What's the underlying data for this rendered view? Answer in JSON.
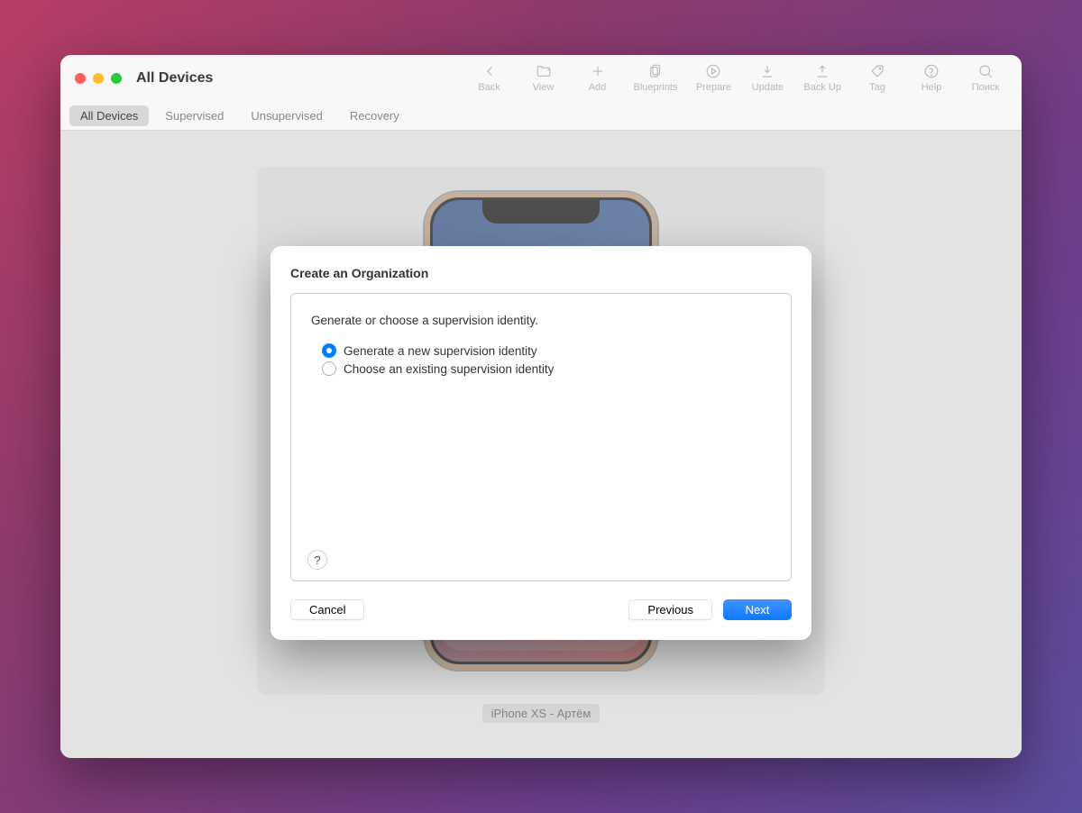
{
  "window": {
    "title": "All Devices"
  },
  "toolbar": {
    "back": "Back",
    "view": "View",
    "add": "Add",
    "blueprints": "Blueprints",
    "prepare": "Prepare",
    "update": "Update",
    "backup": "Back Up",
    "tag": "Tag",
    "help": "Help",
    "search": "Поиск"
  },
  "tabs": {
    "all": "All Devices",
    "supervised": "Supervised",
    "unsupervised": "Unsupervised",
    "recovery": "Recovery"
  },
  "device": {
    "label": "iPhone XS - Артём"
  },
  "dialog": {
    "title": "Create an Organization",
    "instruction": "Generate or choose a supervision identity.",
    "option_generate": "Generate a new supervision identity",
    "option_choose": "Choose an existing supervision identity",
    "help_symbol": "?",
    "cancel": "Cancel",
    "previous": "Previous",
    "next": "Next"
  }
}
